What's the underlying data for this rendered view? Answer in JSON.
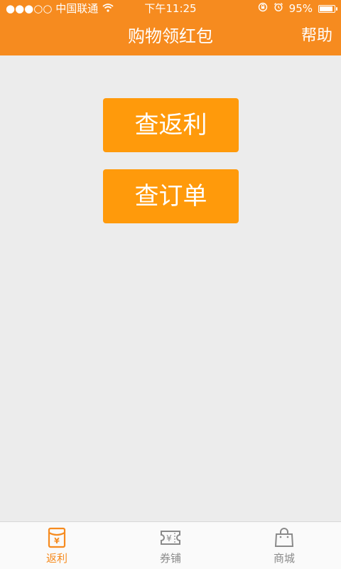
{
  "status_bar": {
    "carrier": "●●●○○ 中国联通",
    "time": "下午11:25",
    "battery": "95%",
    "battery_level": 0.95
  },
  "nav": {
    "title": "购物领红包",
    "help_label": "帮助"
  },
  "actions": {
    "check_rebate": "查返利",
    "check_orders": "查订单"
  },
  "tabs": [
    {
      "label": "返利",
      "icon": "red-envelope-icon",
      "active": true
    },
    {
      "label": "券铺",
      "icon": "coupon-icon",
      "active": false
    },
    {
      "label": "商城",
      "icon": "shopping-bag-icon",
      "active": false
    }
  ],
  "colors": {
    "header": "#f68b1f",
    "button": "#ff9a0b",
    "background": "#ececec",
    "tab_active": "#f68b1f",
    "tab_inactive": "#8a8a8a"
  }
}
